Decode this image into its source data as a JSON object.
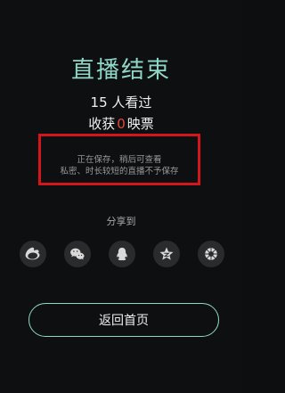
{
  "live_end": {
    "title": "直播结束",
    "viewers_count": "15",
    "viewers_suffix": "人看过",
    "tickets_prefix": "收获",
    "tickets_count": "0",
    "tickets_suffix": "映票"
  },
  "notice": {
    "line1": "正在保存，稍后可查看",
    "line2": "私密、时长较短的直播不予保存",
    "border_color": "#d2161b"
  },
  "share": {
    "label": "分享到",
    "targets": [
      {
        "name": "weibo",
        "icon": "weibo-icon"
      },
      {
        "name": "wechat",
        "icon": "wechat-icon"
      },
      {
        "name": "qq",
        "icon": "qq-icon"
      },
      {
        "name": "qzone",
        "icon": "qzone-star-icon"
      },
      {
        "name": "moments",
        "icon": "moments-icon"
      }
    ]
  },
  "actions": {
    "back_home_label": "返回首页"
  },
  "colors": {
    "accent": "#8fd8c7",
    "ticket_count": "#e0493a",
    "background": "#0e0f11"
  }
}
